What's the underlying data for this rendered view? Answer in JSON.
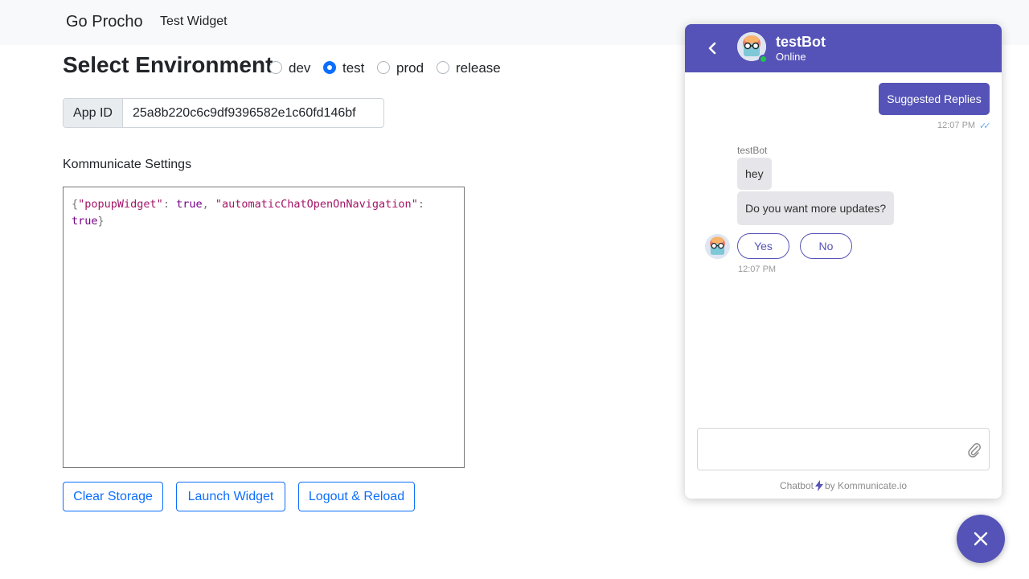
{
  "navbar": {
    "brand": "Go Procho",
    "link": "Test Widget"
  },
  "environment": {
    "title": "Select Environment",
    "options": [
      "dev",
      "test",
      "prod",
      "release"
    ],
    "selected": "test"
  },
  "app_id": {
    "label": "App ID",
    "value": "25a8b220c6c9df9396582e1c60fd146bf"
  },
  "settings": {
    "label": "Kommunicate Settings",
    "key1": "\"popupWidget\"",
    "val1": "true",
    "key2": "\"automaticChatOpenOnNavigation\"",
    "val2": "true"
  },
  "buttons": {
    "clear": "Clear Storage",
    "launch": "Launch Widget",
    "logout": "Logout & Reload"
  },
  "chat": {
    "bot_name": "testBot",
    "status": "Online",
    "outgoing_message": "Suggested Replies",
    "outgoing_time": "12:07 PM",
    "sender_name": "testBot",
    "messages": [
      "hey",
      "Do you want more updates?"
    ],
    "quick_replies": [
      "Yes",
      "No"
    ],
    "incoming_time": "12:07 PM",
    "input_placeholder": "",
    "powered_prefix": "Chatbot",
    "powered_suffix": "by Kommunicate.io"
  },
  "colors": {
    "accent": "#5553b7",
    "primary": "#0d6efd",
    "online": "#1fc44d"
  },
  "icons": [
    "chevron-left-icon",
    "avatar-icon",
    "double-check-icon",
    "paperclip-icon",
    "lightning-icon",
    "close-icon"
  ]
}
